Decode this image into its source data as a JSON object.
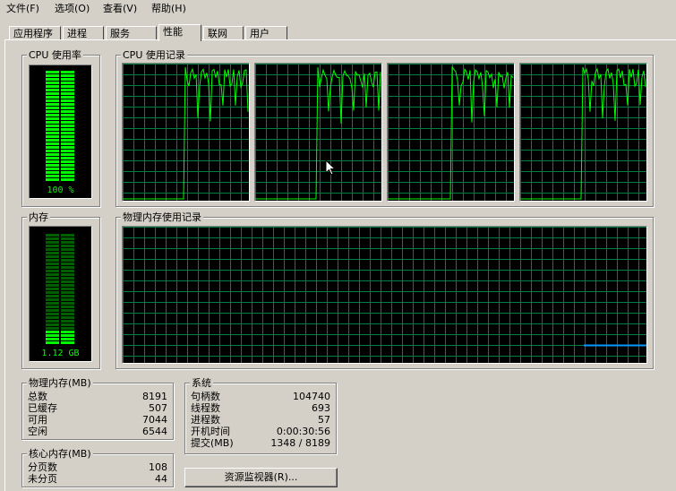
{
  "menu": [
    "文件(F)",
    "选项(O)",
    "查看(V)",
    "帮助(H)"
  ],
  "tabs": [
    "应用程序",
    "进程",
    "服务",
    "性能",
    "联网",
    "用户"
  ],
  "active_tab": 3,
  "cpu_usage": {
    "title": "CPU 使用率",
    "label": "100 %",
    "percent": 100
  },
  "cpu_history": {
    "title": "CPU 使用记录"
  },
  "memory": {
    "title": "内存",
    "label": "1.12 GB",
    "fraction": 0.14
  },
  "memory_history": {
    "title": "物理内存使用记录"
  },
  "physical_memory": {
    "title": "物理内存(MB)",
    "rows": [
      {
        "label": "总数",
        "value": "8191"
      },
      {
        "label": "已缓存",
        "value": "507"
      },
      {
        "label": "可用",
        "value": "7044"
      },
      {
        "label": "空闲",
        "value": "6544"
      }
    ]
  },
  "kernel_memory": {
    "title": "核心内存(MB)",
    "rows": [
      {
        "label": "分页数",
        "value": "108"
      },
      {
        "label": "未分页",
        "value": "44"
      }
    ]
  },
  "system": {
    "title": "系统",
    "rows": [
      {
        "label": "句柄数",
        "value": "104740"
      },
      {
        "label": "线程数",
        "value": "693"
      },
      {
        "label": "进程数",
        "value": "57"
      },
      {
        "label": "开机时间",
        "value": "0:00:30:56"
      },
      {
        "label": "提交(MB)",
        "value": "1348 / 8189"
      }
    ]
  },
  "resource_monitor_button": "资源监视器(R)...",
  "colors": {
    "graph_line": "#00ff00",
    "grid": "#008040",
    "memory_line": "#0099ff",
    "meter_on": "#00ff00",
    "meter_off": "#006000"
  }
}
